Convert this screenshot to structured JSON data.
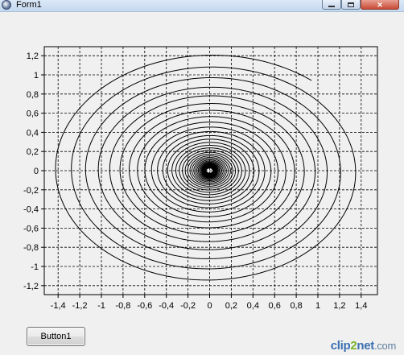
{
  "window": {
    "title": "Form1",
    "icon": "app-globe-icon",
    "controls": {
      "minimize": "minimize-icon",
      "maximize": "maximize-icon",
      "close": "close-icon"
    }
  },
  "button1": {
    "label": "Button1"
  },
  "watermark": {
    "brand": "clip",
    "two": "2",
    "net": "net",
    "tld": ".com"
  },
  "chart_data": {
    "type": "line",
    "title": "",
    "xlabel": "",
    "ylabel": "",
    "xlim": [
      -1.5,
      1.5
    ],
    "ylim": [
      -1.3,
      1.3
    ],
    "grid": true,
    "grid_style": "dashed",
    "x_ticks": [
      "-1,4",
      "-1,2",
      "-1",
      "-0,8",
      "-0,6",
      "-0,4",
      "-0,2",
      "0",
      "0,2",
      "0,4",
      "0,6",
      "0,8",
      "1",
      "1,2",
      "1,4"
    ],
    "y_ticks": [
      "1,2",
      "1",
      "0,8",
      "0,6",
      "0,4",
      "0,2",
      "0",
      "-0,2",
      "-0,4",
      "-0,6",
      "-0,8",
      "-1",
      "-1,2"
    ],
    "series": [
      {
        "curve": "parametric spiral",
        "color": "#000000",
        "x_outer_radius": 1.48,
        "y_outer_radius": 1.22,
        "x_inner_radius": 0.03,
        "y_inner_radius": 0.03,
        "turns": 36,
        "start_point": [
          1.0,
          1.0
        ],
        "end_point": [
          0.0,
          0.0
        ]
      }
    ]
  }
}
